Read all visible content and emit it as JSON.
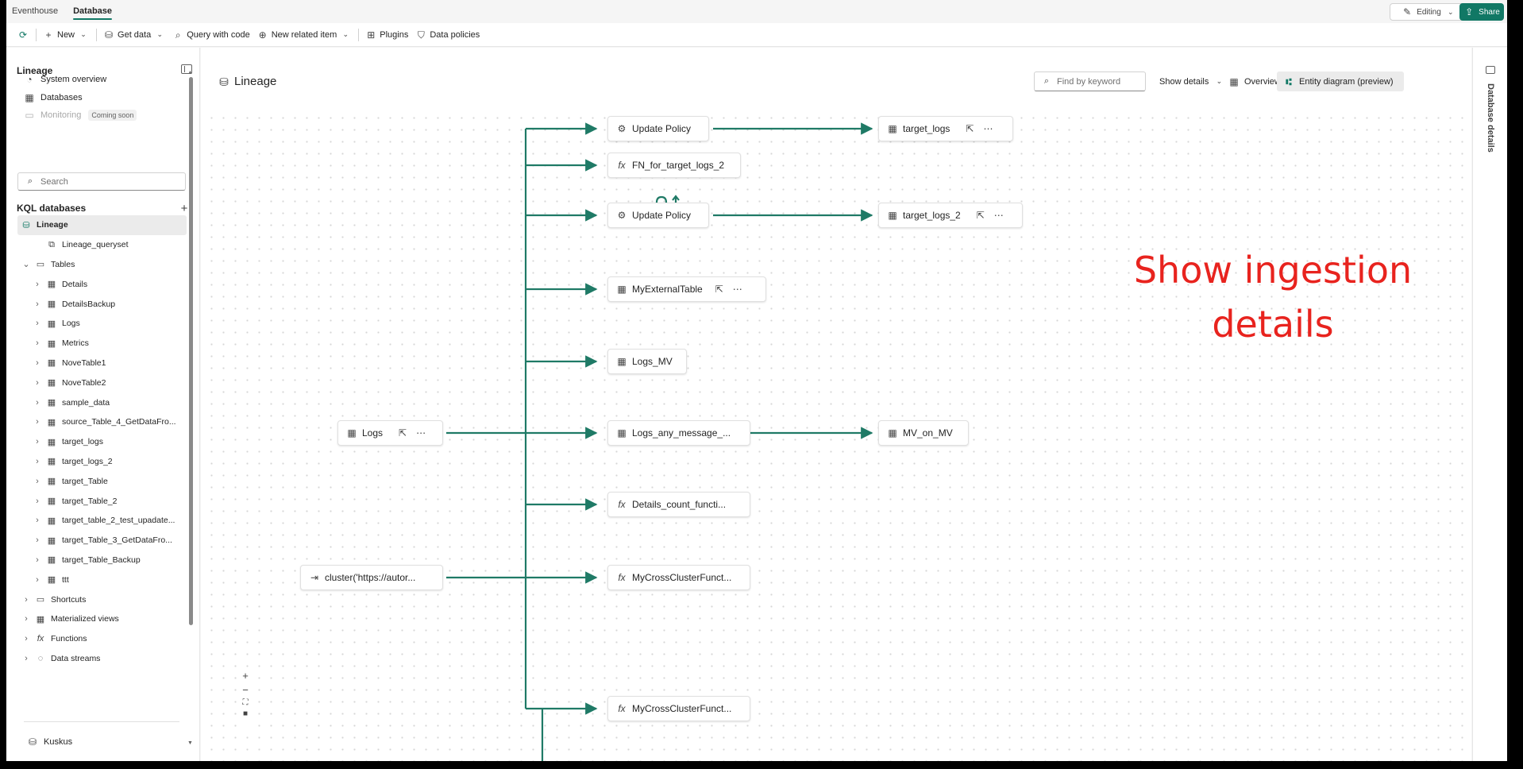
{
  "top_tabs": [
    "Eventhouse",
    "Database"
  ],
  "editing_label": "Editing",
  "share_label": "Share",
  "toolbar": {
    "new": "New",
    "get_data": "Get data",
    "query_with_code": "Query with code",
    "new_related_item": "New related item",
    "plugins": "Plugins",
    "data_policies": "Data policies"
  },
  "sidebar": {
    "title": "Lineage",
    "nav": [
      {
        "label": "System overview",
        "icon": "gauge-icon"
      },
      {
        "label": "Databases",
        "icon": "grid-icon"
      },
      {
        "label": "Monitoring",
        "icon": "monitor-icon",
        "badge": "Coming soon"
      }
    ],
    "search_placeholder": "Search",
    "kql_header": "KQL databases",
    "tree": [
      {
        "label": "Lineage",
        "level": 0,
        "chev": "",
        "icon": "database-icon",
        "selected": true,
        "bold": true
      },
      {
        "label": "Lineage_queryset",
        "level": 2,
        "chev": "",
        "icon": "queryset-icon"
      },
      {
        "label": "Tables",
        "level": 1,
        "chev": "⌄",
        "icon": "folder-icon"
      },
      {
        "label": "Details",
        "level": 2,
        "chev": "›",
        "icon": "table-icon"
      },
      {
        "label": "DetailsBackup",
        "level": 2,
        "chev": "›",
        "icon": "table-icon"
      },
      {
        "label": "Logs",
        "level": 2,
        "chev": "›",
        "icon": "table-icon"
      },
      {
        "label": "Metrics",
        "level": 2,
        "chev": "›",
        "icon": "table-icon"
      },
      {
        "label": "NoveTable1",
        "level": 2,
        "chev": "›",
        "icon": "table-icon"
      },
      {
        "label": "NoveTable2",
        "level": 2,
        "chev": "›",
        "icon": "table-icon"
      },
      {
        "label": "sample_data",
        "level": 2,
        "chev": "›",
        "icon": "table-icon"
      },
      {
        "label": "source_Table_4_GetDataFro...",
        "level": 2,
        "chev": "›",
        "icon": "table-icon"
      },
      {
        "label": "target_logs",
        "level": 2,
        "chev": "›",
        "icon": "table-icon"
      },
      {
        "label": "target_logs_2",
        "level": 2,
        "chev": "›",
        "icon": "table-icon"
      },
      {
        "label": "target_Table",
        "level": 2,
        "chev": "›",
        "icon": "table-icon"
      },
      {
        "label": "target_Table_2",
        "level": 2,
        "chev": "›",
        "icon": "table-icon"
      },
      {
        "label": "target_table_2_test_upadate...",
        "level": 2,
        "chev": "›",
        "icon": "table-icon"
      },
      {
        "label": "target_Table_3_GetDataFro...",
        "level": 2,
        "chev": "›",
        "icon": "table-icon"
      },
      {
        "label": "target_Table_Backup",
        "level": 2,
        "chev": "›",
        "icon": "table-icon"
      },
      {
        "label": "ttt",
        "level": 2,
        "chev": "›",
        "icon": "table-icon"
      },
      {
        "label": "Shortcuts",
        "level": 1,
        "chev": "›",
        "icon": "shortcut-folder-icon"
      },
      {
        "label": "Materialized views",
        "level": 1,
        "chev": "›",
        "icon": "materialized-view-icon"
      },
      {
        "label": "Functions",
        "level": 1,
        "chev": "›",
        "icon": "function-icon"
      },
      {
        "label": "Data streams",
        "level": 1,
        "chev": "›",
        "icon": "data-stream-icon"
      }
    ],
    "footer_item": "Kuskus"
  },
  "main": {
    "title": "Lineage",
    "find_placeholder": "Find by keyword",
    "show_details": "Show details",
    "overview": "Overview",
    "entity_diagram": "Entity diagram (preview)"
  },
  "right_rail_label": "Database details",
  "nodes": {
    "update_policy_1": "Update Policy",
    "fn_target_logs_2": "FN_for_target_logs_2",
    "update_policy_2": "Update Policy",
    "my_external_table": "MyExternalTable",
    "logs_mv": "Logs_MV",
    "logs_any_message": "Logs_any_message_...",
    "details_count": "Details_count_functi...",
    "my_cross_cluster_1": "MyCrossClusterFunct...",
    "my_cross_cluster_2": "MyCrossClusterFunct...",
    "target_logs": "target_logs",
    "target_logs_2": "target_logs_2",
    "mv_on_mv": "MV_on_MV",
    "logs": "Logs",
    "cluster": "cluster('https://autor..."
  },
  "overlay_text": [
    "Show ingestion",
    "details"
  ],
  "colors": {
    "accent": "#117865",
    "edge": "#1f7a66",
    "overlay": "#e8231e"
  }
}
